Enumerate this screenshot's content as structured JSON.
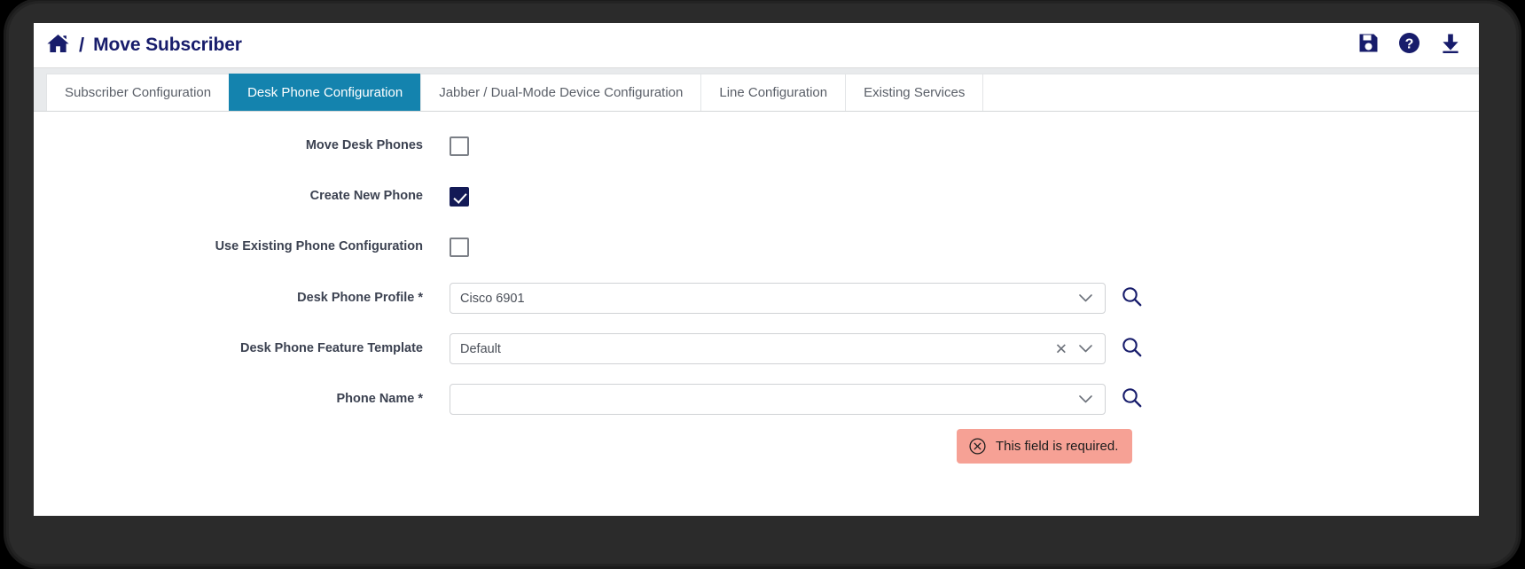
{
  "header": {
    "home_icon": "home-icon",
    "separator": "/",
    "title": "Move Subscriber",
    "actions": [
      {
        "name": "save-icon",
        "label": "Save"
      },
      {
        "name": "help-icon",
        "label": "Help"
      },
      {
        "name": "download-icon",
        "label": "Download"
      }
    ]
  },
  "tabs": [
    {
      "label": "Subscriber Configuration",
      "active": false
    },
    {
      "label": "Desk Phone Configuration",
      "active": true
    },
    {
      "label": "Jabber / Dual-Mode Device Configuration",
      "active": false
    },
    {
      "label": "Line Configuration",
      "active": false
    },
    {
      "label": "Existing Services",
      "active": false
    }
  ],
  "form": {
    "checkboxes": [
      {
        "label": "Move Desk Phones",
        "checked": false
      },
      {
        "label": "Create New Phone",
        "checked": true
      },
      {
        "label": "Use Existing Phone Configuration",
        "checked": false
      }
    ],
    "selects": [
      {
        "label": "Desk Phone Profile *",
        "value": "Cisco 6901",
        "placeholder": "",
        "has_clear": false,
        "caret_icon": "chevron-down-icon",
        "search_icon": "search-icon"
      },
      {
        "label": "Desk Phone Feature Template",
        "value": "Default",
        "placeholder": "",
        "has_clear": true,
        "clear_icon": "clear-icon",
        "caret_icon": "chevron-down-icon",
        "search_icon": "search-icon"
      },
      {
        "label": "Phone Name *",
        "value": "",
        "placeholder": "",
        "has_clear": false,
        "caret_icon": "chevron-down-icon",
        "search_icon": "search-icon"
      }
    ],
    "error": {
      "icon": "error-circle-icon",
      "text": "This field is required."
    }
  },
  "colors": {
    "brand_navy": "#171c6b",
    "tab_active": "#1483ae",
    "checkbox_checked": "#131a56",
    "error_bg": "#f6a195",
    "tabstrip_bg": "#e8eaec"
  }
}
